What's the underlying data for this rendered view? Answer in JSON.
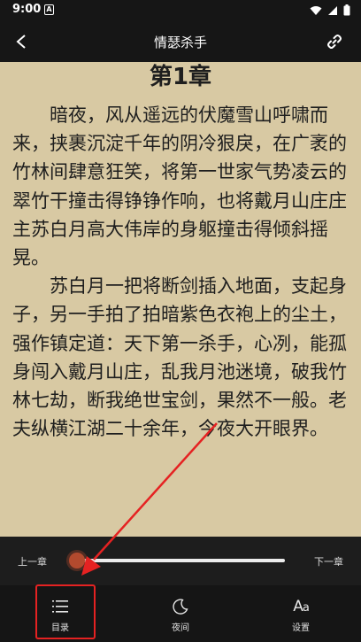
{
  "status_bar": {
    "time": "9:00",
    "notification_glyph": "A"
  },
  "header": {
    "title": "情瑟杀手"
  },
  "reader": {
    "chapter_title": "第1章",
    "paragraphs": [
      "暗夜，风从遥远的伏魔雪山呼啸而来，挟裹沉淀千年的阴冷狠戾，在广袤的竹林间肆意狂笑，将第一世家气势凌云的翠竹干撞击得铮铮作响，也将戴月山庄庄主苏白月高大伟岸的身躯撞击得倾斜摇晃。",
      "苏白月一把将断剑插入地面，支起身子，另一手拍了拍暗紫色衣袍上的尘土，强作镇定道：天下第一杀手，心冽，能孤身闯入戴月山庄，乱我月池迷境，破我竹林七劫，断我绝世宝剑，果然不一般。老夫纵横江湖二十余年，今夜大开眼界。"
    ]
  },
  "controls": {
    "prev_chapter": "上一章",
    "next_chapter": "下一章",
    "progress": 0.02
  },
  "nav": {
    "catalog": "目录",
    "night": "夜间",
    "settings": "设置"
  },
  "icons": {
    "back": "back-arrow-icon",
    "link": "link-icon",
    "catalog": "list-icon",
    "night": "moon-icon",
    "settings": "font-size-icon"
  },
  "colors": {
    "paper": "#d8c9a3",
    "bar": "#161616",
    "slider_thumb": "#b34a2e",
    "annotation": "#e52222"
  }
}
